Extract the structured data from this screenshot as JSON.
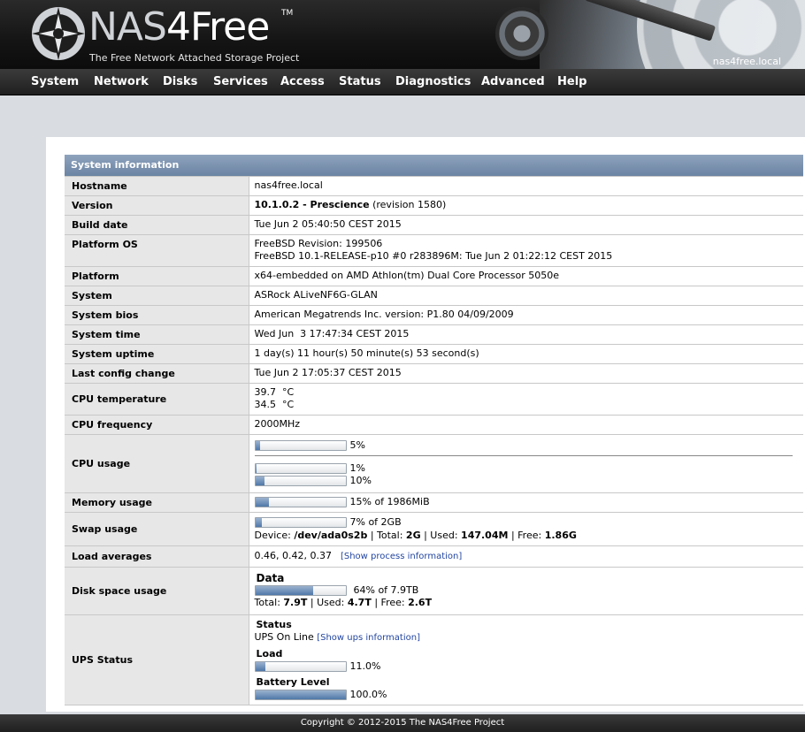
{
  "header": {
    "logo_prefix": "NAS",
    "logo_four": "4",
    "logo_suffix": "Free",
    "tm": "TM",
    "tagline": "The Free Network Attached Storage Project",
    "hostname": "nas4free.local"
  },
  "nav": [
    "System",
    "Network",
    "Disks",
    "Services",
    "Access",
    "Status",
    "Diagnostics",
    "Advanced",
    "Help"
  ],
  "section_title": "System information",
  "rows": {
    "hostname": {
      "label": "Hostname",
      "value": "nas4free.local"
    },
    "version": {
      "label": "Version",
      "bold": "10.1.0.2 - Prescience",
      "rest": " (revision 1580)"
    },
    "build_date": {
      "label": "Build date",
      "value": "Tue Jun 2 05:40:50 CEST 2015"
    },
    "platform_os": {
      "label": "Platform OS",
      "line1": "FreeBSD Revision: 199506",
      "line2": "FreeBSD 10.1-RELEASE-p10 #0 r283896M: Tue Jun 2 01:22:12 CEST 2015"
    },
    "platform": {
      "label": "Platform",
      "value": "x64-embedded on AMD Athlon(tm) Dual Core Processor 5050e"
    },
    "system": {
      "label": "System",
      "value": "ASRock ALiveNF6G-GLAN"
    },
    "system_bios": {
      "label": "System bios",
      "value": "American Megatrends Inc. version: P1.80 04/09/2009"
    },
    "system_time": {
      "label": "System time",
      "value": "Wed Jun  3 17:47:34 CEST 2015"
    },
    "system_uptime": {
      "label": "System uptime",
      "value": "1 day(s) 11 hour(s) 50 minute(s) 53 second(s)"
    },
    "last_config": {
      "label": "Last config change",
      "value": "Tue Jun 2 17:05:37 CEST 2015"
    },
    "cpu_temp": {
      "label": "CPU temperature",
      "line1": "39.7  °C",
      "line2": "34.5  °C"
    },
    "cpu_freq": {
      "label": "CPU frequency",
      "value": "2000MHz"
    },
    "cpu_usage": {
      "label": "CPU usage",
      "total_pct": 5,
      "total_text": "5%",
      "core0_pct": 1,
      "core0_text": "1%",
      "core1_pct": 10,
      "core1_text": "10%"
    },
    "memory": {
      "label": "Memory usage",
      "pct": 15,
      "text": "15% of 1986MiB"
    },
    "swap": {
      "label": "Swap usage",
      "pct": 7,
      "text": "7% of 2GB",
      "device_label": "Device: ",
      "device": "/dev/ada0s2b",
      "total_label": " | Total: ",
      "total": "2G",
      "used_label": " | Used: ",
      "used": "147.04M",
      "free_label": " | Free: ",
      "free": "1.86G"
    },
    "load": {
      "label": "Load averages",
      "value": "0.46, 0.42, 0.37",
      "link": "[Show process information]"
    },
    "disk": {
      "label": "Disk space usage",
      "name": "Data",
      "pct": 64,
      "text": "64% of 7.9TB",
      "total_label": "Total: ",
      "total": "7.9T",
      "used_label": " | Used: ",
      "used": "4.7T",
      "free_label": " | Free: ",
      "free": "2.6T"
    },
    "ups": {
      "label": "UPS Status",
      "status_head": "Status",
      "status_text": "UPS On Line ",
      "status_link": "[Show ups information]",
      "load_head": "Load",
      "load_pct": 11,
      "load_text": "11.0%",
      "battery_head": "Battery Level",
      "battery_pct": 100,
      "battery_text": "100.0%"
    }
  },
  "footer": "Copyright © 2012-2015 The NAS4Free Project"
}
